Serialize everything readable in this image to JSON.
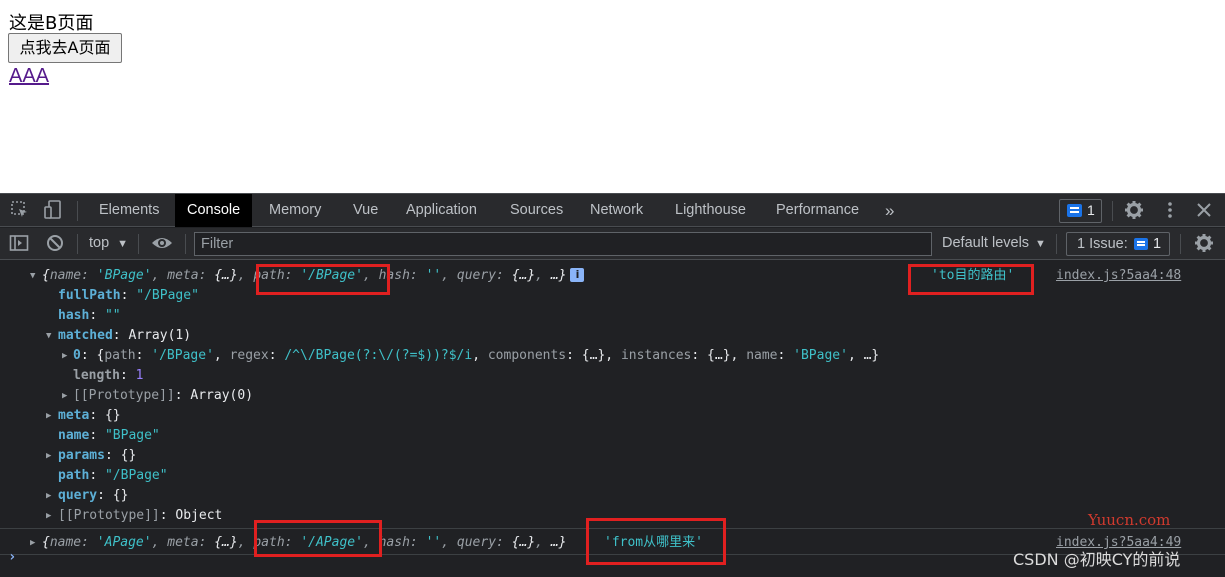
{
  "page": {
    "title": "这是B页面",
    "button_label": "点我去A页面",
    "link_text": "AAA"
  },
  "devtools": {
    "tabs": [
      "Elements",
      "Console",
      "Memory",
      "Vue",
      "Application",
      "Sources",
      "Network",
      "Lighthouse",
      "Performance"
    ],
    "active_tab": "Console",
    "more_tabs_icon": "»",
    "message_count": "1",
    "toolbar": {
      "context": "top",
      "filter_placeholder": "Filter",
      "levels": "Default levels",
      "issues_label": "1 Issue:",
      "issues_count": "1"
    },
    "icons": [
      "inspect-icon",
      "device-toggle-icon",
      "sidebar-toggle-icon",
      "clear-console-icon",
      "eye-icon",
      "gear-icon",
      "kebab-menu-icon",
      "close-icon",
      "chat-icon"
    ]
  },
  "console": {
    "entry1": {
      "summary": {
        "open": "{",
        "name_key": "name",
        "name_val": "'BPage'",
        "meta_key": "meta",
        "meta_val": "{…}",
        "path_key": "path",
        "path_val": "'/BPage'",
        "hash_key": "hash",
        "hash_val": "''",
        "query_key": "query",
        "query_val": "{…}",
        "tail": "…}"
      },
      "label": "'to目的路由'",
      "source": "index.js?5aa4:48",
      "fullPath_key": "fullPath",
      "fullPath_val": "\"/BPage\"",
      "hash_key": "hash",
      "hash_val": "\"\"",
      "matched_key": "matched",
      "matched_val": "Array(1)",
      "m0_key": "0",
      "m0_path_key": "path",
      "m0_path_val": "'/BPage'",
      "m0_regex_key": "regex",
      "m0_regex_val": "/^\\/BPage(?:\\/(?=$))?$/i",
      "m0_components_key": "components",
      "m0_components_val": "{…}",
      "m0_instances_key": "instances",
      "m0_instances_val": "{…}",
      "m0_name_key": "name",
      "m0_name_val": "'BPage'",
      "m0_tail": "…}",
      "length_key": "length",
      "length_val": "1",
      "proto_arr_key": "[[Prototype]]",
      "proto_arr_val": "Array(0)",
      "meta_key": "meta",
      "meta_val": "{}",
      "name_key": "name",
      "name_val": "\"BPage\"",
      "params_key": "params",
      "params_val": "{}",
      "path_key": "path",
      "path_val": "\"/BPage\"",
      "query_key": "query",
      "query_val": "{}",
      "proto_key": "[[Prototype]]",
      "proto_val": "Object"
    },
    "entry2": {
      "summary": {
        "open": "{",
        "name_key": "name",
        "name_val": "'APage'",
        "meta_key": "meta",
        "meta_val": "{…}",
        "path_key": "path",
        "path_val": "'/APage'",
        "hash_key": "hash",
        "hash_val": "''",
        "query_key": "query",
        "query_val": "{…}",
        "tail": "…}"
      },
      "label": "'from从哪里来'",
      "source": "index.js?5aa4:49"
    }
  },
  "watermarks": {
    "site": "Yuucn.com",
    "author": "CSDN @初映CY的前说"
  },
  "colors": {
    "devtools_bg": "#202124",
    "highlight_box": "#e02020",
    "string": "#3fc1c9",
    "key": "#5db0d7",
    "number": "#9980ff"
  }
}
